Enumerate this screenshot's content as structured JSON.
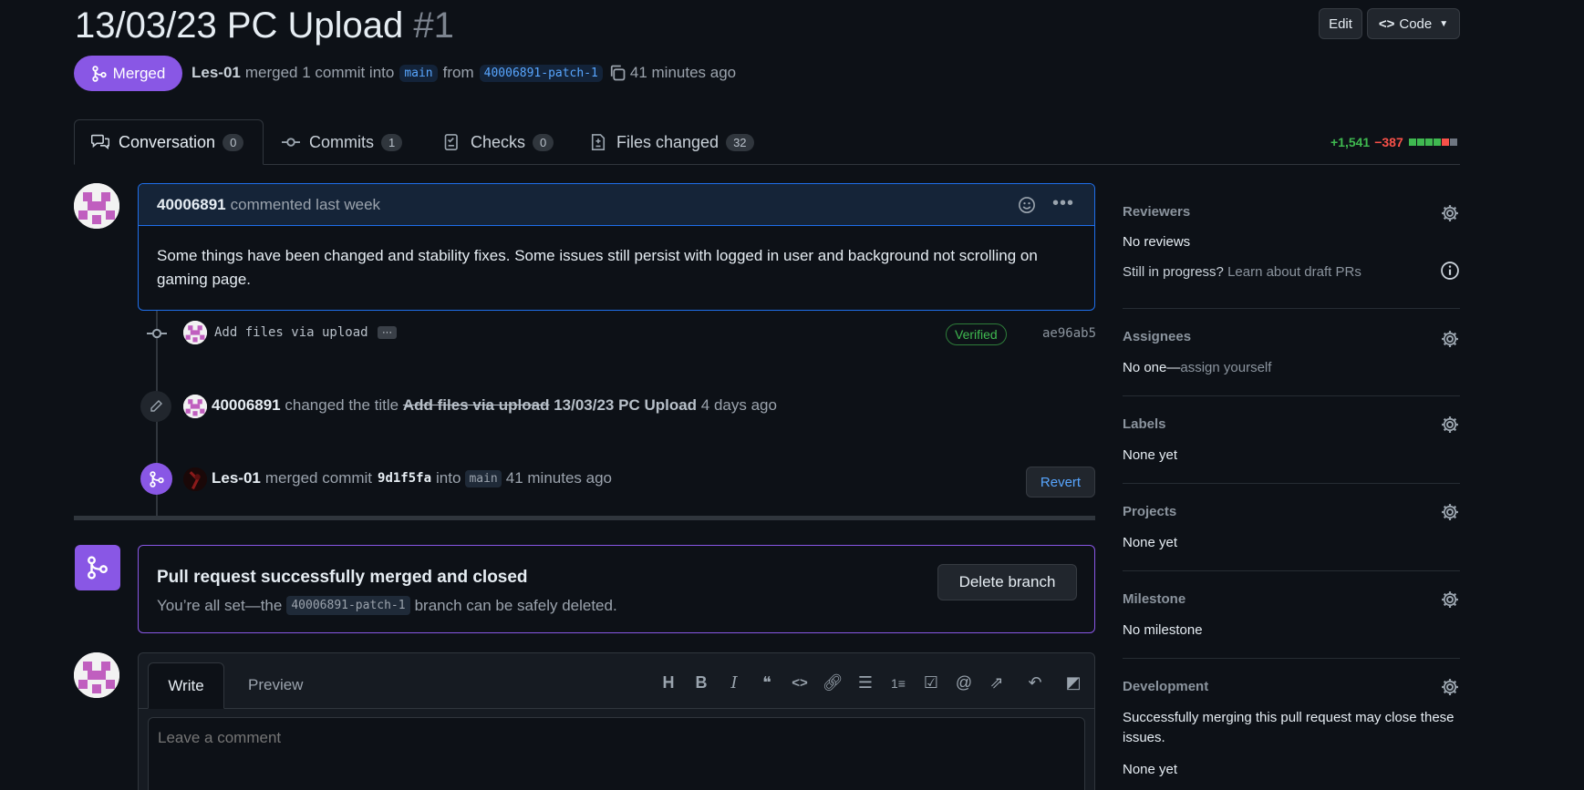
{
  "pr": {
    "title": "13/03/23 PC Upload",
    "number": "#1",
    "status": "Merged",
    "author": "Les-01",
    "merged_text": "merged 1 commit into",
    "base_branch": "main",
    "from_text": "from",
    "head_branch": "40006891-patch-1",
    "time": "41 minutes ago"
  },
  "header_buttons": {
    "edit": "Edit",
    "code": "Code"
  },
  "tabs": [
    {
      "label": "Conversation",
      "count": "0"
    },
    {
      "label": "Commits",
      "count": "1"
    },
    {
      "label": "Checks",
      "count": "0"
    },
    {
      "label": "Files changed",
      "count": "32"
    }
  ],
  "diffstat": {
    "additions": "+1,541",
    "deletions": "−387"
  },
  "comment": {
    "author": "40006891",
    "meta": "commented last week",
    "body": "Some things have been changed and stability fixes. Some issues still persist with logged in user and background not scrolling on gaming page."
  },
  "commit": {
    "message": "Add files via upload",
    "ellipsis": "···",
    "verified": "Verified",
    "sha": "ae96ab5"
  },
  "rename_event": {
    "author": "40006891",
    "action": "changed the title",
    "old_title": "Add files via upload",
    "new_title": "13/03/23 PC Upload",
    "time": "4 days ago"
  },
  "merge_event": {
    "author": "Les-01",
    "action": "merged commit",
    "sha": "9d1f5fa",
    "into_text": "into",
    "branch": "main",
    "time": "41 minutes ago",
    "revert": "Revert"
  },
  "merged_box": {
    "title": "Pull request successfully merged and closed",
    "text_before": "You’re all set—the",
    "branch": "40006891-patch-1",
    "text_after": "branch can be safely deleted.",
    "delete_button": "Delete branch"
  },
  "composer": {
    "write_tab": "Write",
    "preview_tab": "Preview",
    "placeholder": "Leave a comment",
    "toolbar_icons": [
      "heading-icon",
      "bold-icon",
      "italic-icon",
      "quote-icon",
      "code-icon",
      "link-icon",
      "unordered-list-icon",
      "ordered-list-icon",
      "task-list-icon",
      "mention-icon",
      "reference-icon",
      "reply-icon",
      "fullscreen-icon"
    ]
  },
  "sidebar": {
    "reviewers": {
      "title": "Reviewers",
      "value": "No reviews",
      "hint_prefix": "Still in progress?",
      "hint_link": "Learn about draft PRs"
    },
    "assignees": {
      "title": "Assignees",
      "value_prefix": "No one—",
      "value_link": "assign yourself"
    },
    "labels": {
      "title": "Labels",
      "value": "None yet"
    },
    "projects": {
      "title": "Projects",
      "value": "None yet"
    },
    "milestone": {
      "title": "Milestone",
      "value": "No milestone"
    },
    "development": {
      "title": "Development",
      "desc": "Successfully merging this pull request may close these issues.",
      "value": "None yet"
    }
  },
  "colors": {
    "merged_purple": "#8957e5",
    "accent_blue": "#2f81f7",
    "green": "#3fb950",
    "red": "#f85149"
  }
}
